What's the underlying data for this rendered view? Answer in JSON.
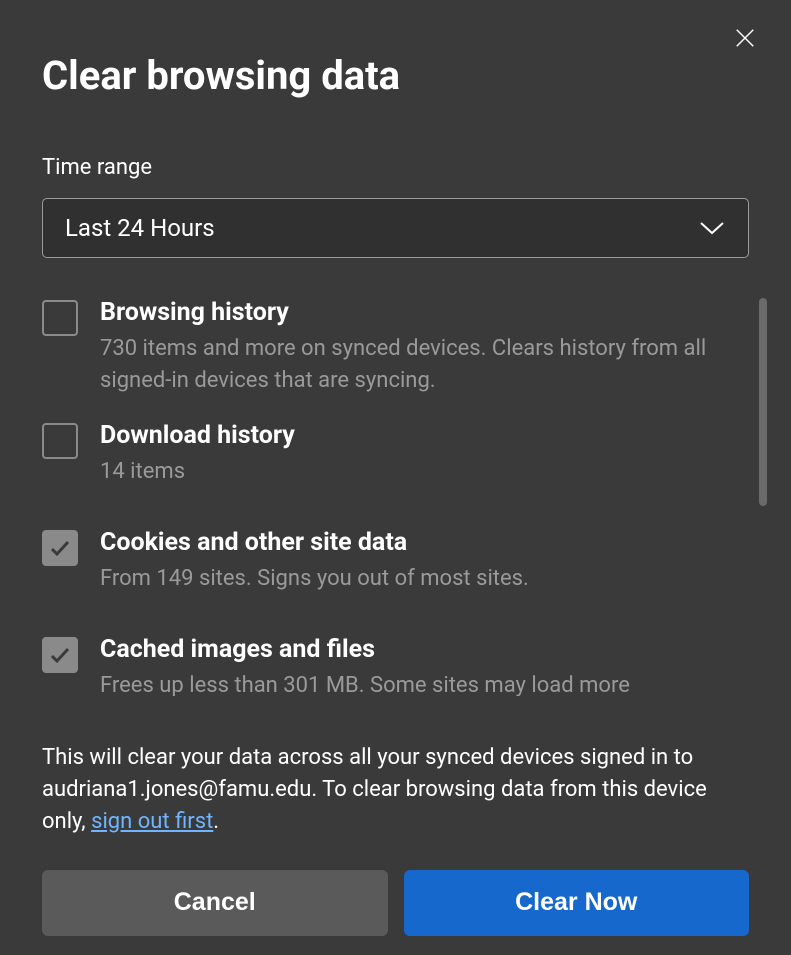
{
  "dialog": {
    "title": "Clear browsing data",
    "time_range_label": "Time range",
    "time_range_value": "Last 24 Hours"
  },
  "options": [
    {
      "checked": false,
      "title": "Browsing history",
      "desc": "730 items and more on synced devices. Clears history from all signed-in devices that are syncing."
    },
    {
      "checked": false,
      "title": "Download history",
      "desc": "14 items"
    },
    {
      "checked": true,
      "title": "Cookies and other site data",
      "desc": "From 149 sites. Signs you out of most sites."
    },
    {
      "checked": true,
      "title": "Cached images and files",
      "desc": "Frees up less than 301 MB. Some sites may load more"
    }
  ],
  "footer": {
    "prefix": "This will clear your data across all your synced devices signed in to audriana1.jones@famu.edu. To clear browsing data from this device only, ",
    "link": "sign out first",
    "suffix": "."
  },
  "buttons": {
    "cancel": "Cancel",
    "clear": "Clear Now"
  }
}
